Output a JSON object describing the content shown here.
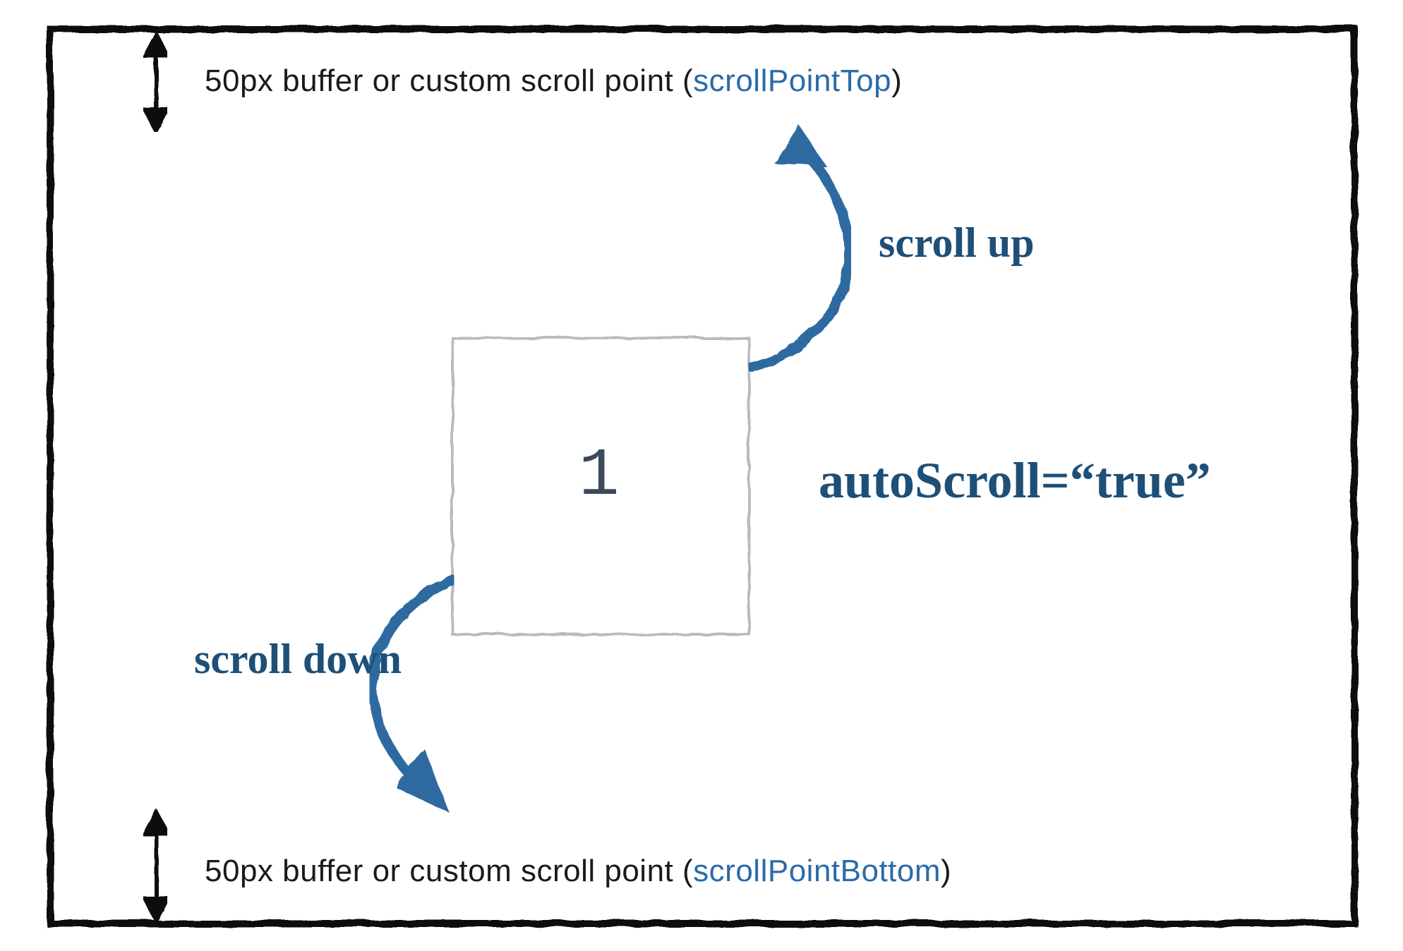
{
  "buffer_top": {
    "text": "50px buffer or custom scroll point (",
    "ref": "scrollPointTop",
    "close": ")"
  },
  "buffer_bottom": {
    "text": "50px buffer or custom scroll point (",
    "ref": "scrollPointBottom",
    "close": ")"
  },
  "scroll_up_label": "scroll up",
  "scroll_down_label": "scroll down",
  "autoscroll_label": "autoScroll=“true”",
  "box_number": "1",
  "colors": {
    "blue_line": "#4a9eea",
    "dark_blue": "#1e4f77",
    "border": "#111111"
  }
}
